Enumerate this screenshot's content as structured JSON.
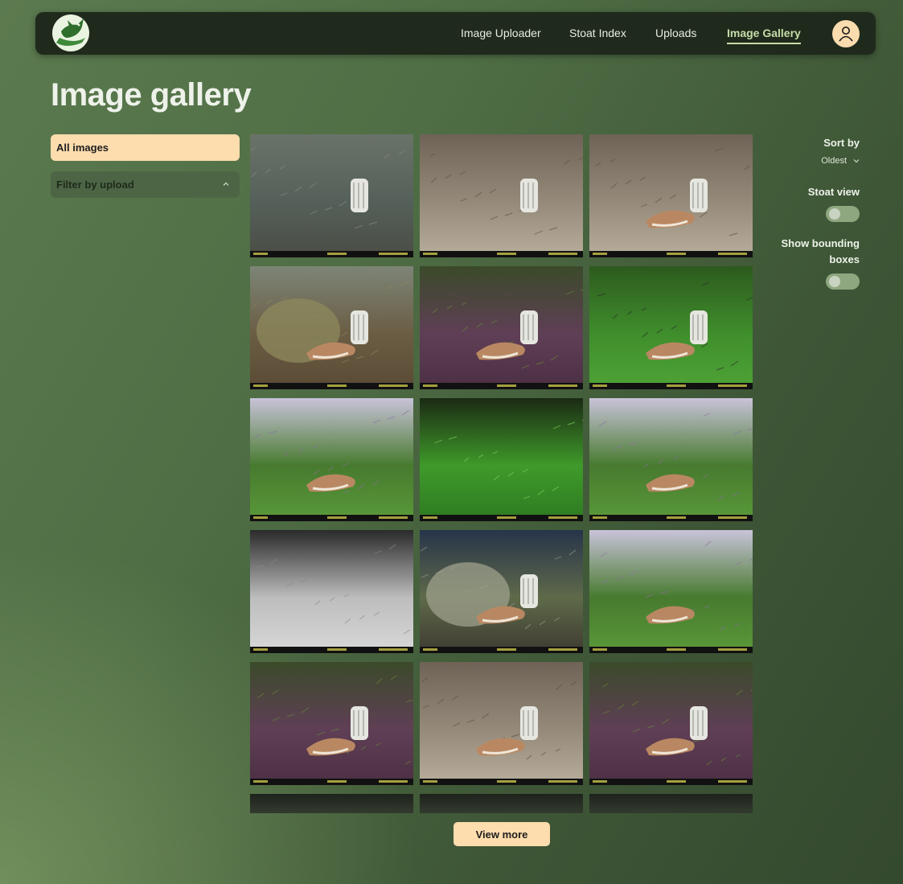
{
  "nav": {
    "items": [
      "Image Uploader",
      "Stoat Index",
      "Uploads",
      "Image Gallery"
    ],
    "active": "Image Gallery",
    "colors": {
      "bar": "#1f2a1c",
      "active": "#c6dca8",
      "avatar": "#fbdcae"
    }
  },
  "page": {
    "title": "Image gallery"
  },
  "sidebar": {
    "all_images": "All images",
    "filter_by_upload": "Filter by upload",
    "accent": "#fddcae"
  },
  "controls": {
    "sort_label": "Sort by",
    "sort_value": "Oldest",
    "stoat_view_label": "Stoat view",
    "stoat_view_on": false,
    "bounding_boxes_label": "Show bounding boxes",
    "bounding_boxes_on": false
  },
  "gallery": {
    "images": [
      {
        "scene": "leaf-litter",
        "stoat": false,
        "trap": true
      },
      {
        "scene": "dry-twigs",
        "stoat": false,
        "trap": true
      },
      {
        "scene": "dry-twigs",
        "stoat": true,
        "trap": true
      },
      {
        "scene": "boulder",
        "stoat": true,
        "trap": true
      },
      {
        "scene": "soil-grass",
        "stoat": true,
        "trap": true
      },
      {
        "scene": "green-grass",
        "stoat": true,
        "trap": true
      },
      {
        "scene": "bright-shrub",
        "stoat": true,
        "trap": false
      },
      {
        "scene": "green-glow",
        "stoat": false,
        "trap": false
      },
      {
        "scene": "bright-shrub",
        "stoat": true,
        "trap": false
      },
      {
        "scene": "night-ir",
        "stoat": false,
        "trap": false
      },
      {
        "scene": "boulder-blue",
        "stoat": true,
        "trap": true
      },
      {
        "scene": "bright-shrub",
        "stoat": true,
        "trap": false
      },
      {
        "scene": "soil-grass",
        "stoat": true,
        "trap": true
      },
      {
        "scene": "dry-twigs",
        "stoat": true,
        "trap": true
      },
      {
        "scene": "soil-grass",
        "stoat": true,
        "trap": true
      },
      {
        "scene": "dark-partial",
        "stoat": false,
        "trap": false
      },
      {
        "scene": "dark-partial",
        "stoat": false,
        "trap": false
      },
      {
        "scene": "dark-partial",
        "stoat": false,
        "trap": false
      }
    ],
    "view_more": "View more"
  }
}
